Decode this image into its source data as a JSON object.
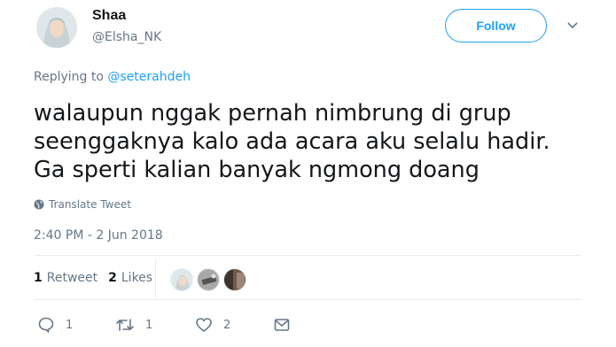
{
  "user": {
    "display_name": "Shaa",
    "handle": "@Elsha_NK"
  },
  "follow_label": "Follow",
  "reply_context": {
    "prefix": "Replying to ",
    "mention": "@seterahdeh"
  },
  "tweet": {
    "text": "walaupun nggak pernah nimbrung di grup\nseenggaknya kalo ada acara aku selalu hadir.\nGa sperti kalian banyak ngmong doang",
    "translate_label": "Translate Tweet",
    "timestamp": "2:40 PM - 2 Jun 2018"
  },
  "stats": {
    "retweet_count": "1",
    "retweet_label": "Retweet",
    "like_count": "2",
    "like_label": "Likes"
  },
  "actions": {
    "reply_count": "1",
    "retweet_count": "1",
    "like_count": "2"
  },
  "colors": {
    "accent": "#1da1f2",
    "secondary_text": "#657786",
    "primary_text": "#14171a",
    "divider": "#e6ecf0"
  }
}
